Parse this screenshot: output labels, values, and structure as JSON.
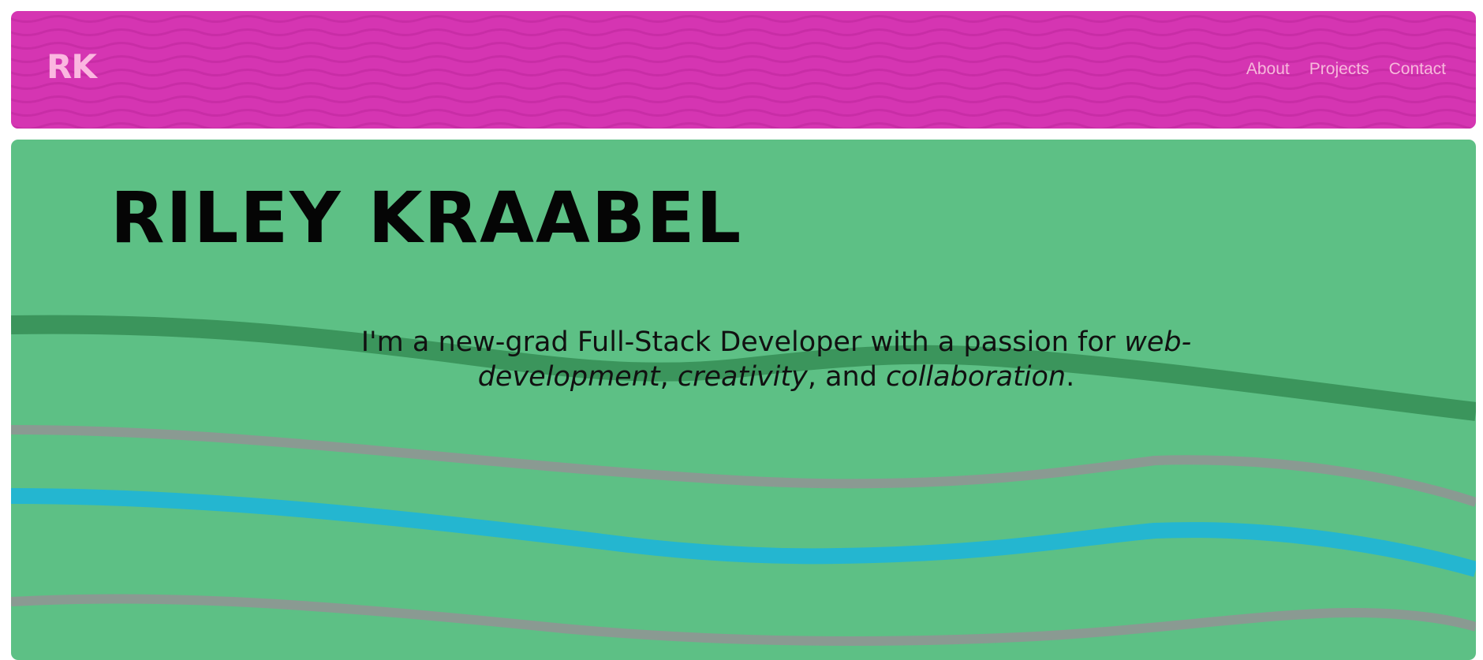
{
  "colors": {
    "header_bg": "#d535b2",
    "header_pattern": "#c82da6",
    "logo": "#fbb7e0",
    "nav_link": "#f7b9dc",
    "hero_bg": "#5dc085",
    "wave_dark_green": "#3b955c",
    "wave_gray": "#8a9a92",
    "wave_cyan": "#24b6d0",
    "title": "#050505"
  },
  "header": {
    "logo": "RK",
    "nav": [
      {
        "label": "About"
      },
      {
        "label": "Projects"
      },
      {
        "label": "Contact"
      }
    ]
  },
  "hero": {
    "title": "RILEY KRAABEL",
    "tagline": {
      "intro": "I'm a new-grad Full-Stack Developer with a passion for ",
      "emph1": "web-development",
      "sep1": ", ",
      "emph2": "creativity",
      "sep2": ", and ",
      "emph3": "collaboration",
      "end": "."
    }
  }
}
